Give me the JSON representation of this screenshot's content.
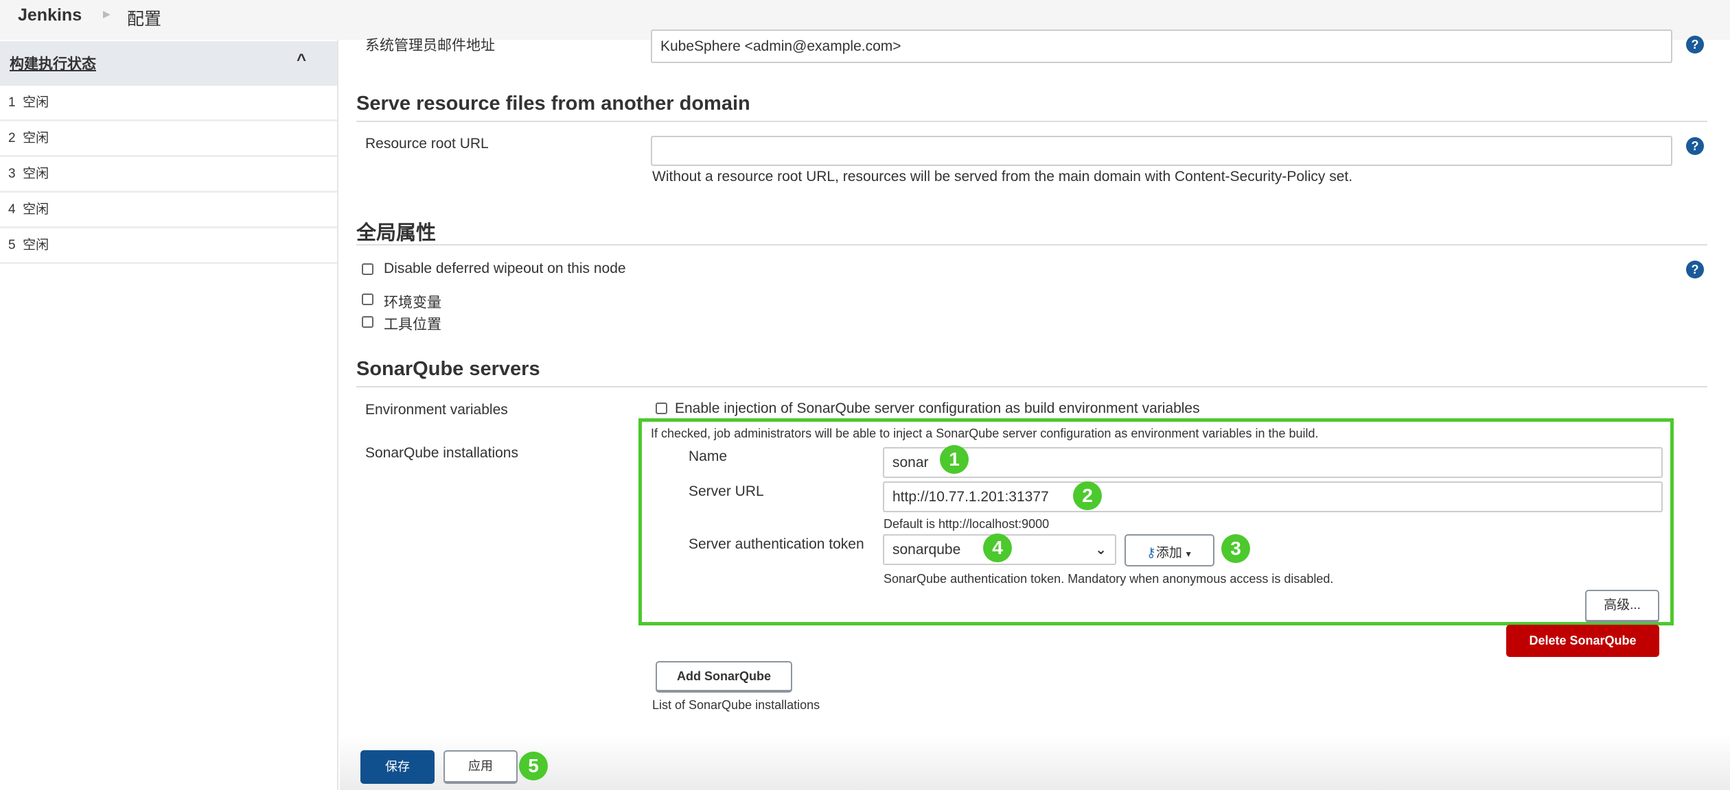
{
  "header": {
    "brand": "Jenkins",
    "breadcrumb": "配置"
  },
  "sidebar": {
    "title": "构建执行状态",
    "executors": [
      {
        "num": "1",
        "status": "空闲"
      },
      {
        "num": "2",
        "status": "空闲"
      },
      {
        "num": "3",
        "status": "空闲"
      },
      {
        "num": "4",
        "status": "空闲"
      },
      {
        "num": "5",
        "status": "空闲"
      }
    ]
  },
  "admin_email": {
    "label": "系统管理员邮件地址",
    "value": "KubeSphere <admin@example.com>"
  },
  "resource": {
    "heading": "Serve resource files from another domain",
    "label": "Resource root URL",
    "value": "",
    "help": "Without a resource root URL, resources will be served from the main domain with Content-Security-Policy set."
  },
  "global": {
    "heading": "全局属性",
    "options": [
      "Disable deferred wipeout on this node",
      "环境变量",
      "工具位置"
    ]
  },
  "sonar": {
    "heading": "SonarQube servers",
    "env_label": "Environment variables",
    "env_checkbox": "Enable injection of SonarQube server configuration as build environment variables",
    "env_help": "If checked, job administrators will be able to inject a SonarQube server configuration as environment variables in the build.",
    "installations_label": "SonarQube installations",
    "name_label": "Name",
    "name_value": "sonar",
    "url_label": "Server URL",
    "url_value": "http://10.77.1.201:31377",
    "url_help": "Default is http://localhost:9000",
    "token_label": "Server authentication token",
    "token_value": "sonarqube",
    "add_label": "添加",
    "token_help": "SonarQube authentication token. Mandatory when anonymous access is disabled.",
    "advanced": "高级...",
    "delete": "Delete SonarQube",
    "add_sonar": "Add SonarQube",
    "list_help": "List of SonarQube installations"
  },
  "footer": {
    "save": "保存",
    "apply": "应用"
  },
  "badges": [
    "1",
    "2",
    "3",
    "4",
    "5"
  ],
  "colors": {
    "accent": "#4cc92d",
    "primary": "#11508e",
    "danger": "#c00000",
    "help": "#1a5a99"
  }
}
